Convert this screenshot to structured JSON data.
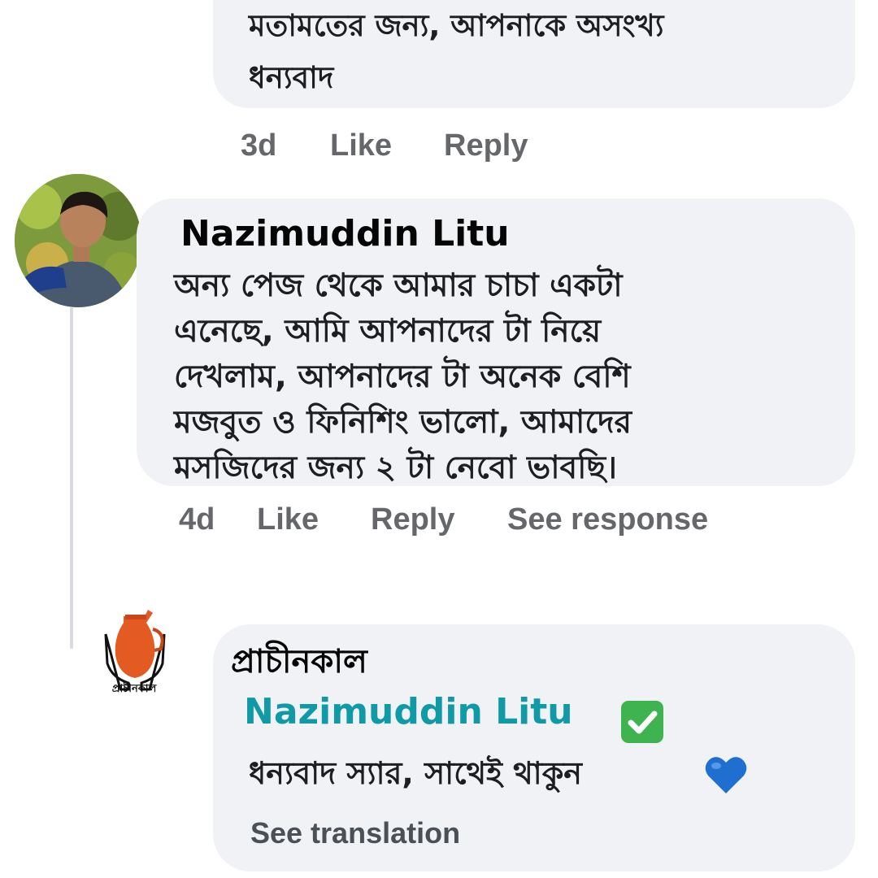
{
  "previous_comment": {
    "text_lines": [
      "মতামতের জন্য, আপনাকে অসংখ্য",
      "ধন্যবাদ"
    ],
    "actions": {
      "time": "3d",
      "like": "Like",
      "reply": "Reply"
    }
  },
  "main_comment": {
    "author": "Nazimuddin Litu",
    "text_lines": [
      "অন্য পেজ থেকে আমার চাচা একটা",
      "এনেছে, আমি আপনাদের টা নিয়ে",
      "দেখলাম, আপনাদের টা অনেক বেশি",
      "মজবুত ও ফিনিশিং ভালো, আমাদের",
      "মসজিদের জন্য ২ টা নেবো ভাবছি।"
    ],
    "actions": {
      "time": "4d",
      "like": "Like",
      "reply": "Reply",
      "see_response": "See response"
    }
  },
  "reply": {
    "logo_caption": "প্রাচীনকাল",
    "author": "প্রাচীনকাল",
    "mention": "Nazimuddin Litu",
    "mention_badge_icon": "check-mark-button-icon",
    "text": "ধন্যবাদ স্যার, সাথেই থাকুন",
    "emoji_icon": "blue-heart-icon",
    "see_translation": "See translation"
  },
  "colors": {
    "bubble": "#f0f2f5",
    "meta_text": "#65676b",
    "mention": "#0f9aa6",
    "check_badge": "#3fb34f",
    "heart": "#1f6fd1",
    "logo_jug": "#e35b22"
  }
}
